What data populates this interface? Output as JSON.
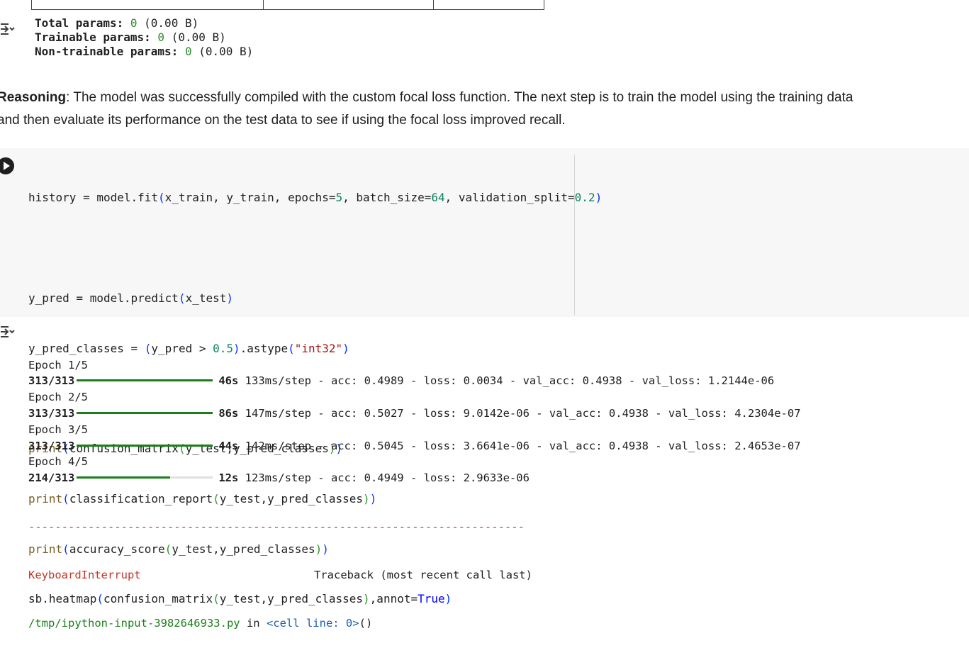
{
  "params": {
    "total_label": "Total params:",
    "total_value": "0",
    "total_size": "(0.00 B)",
    "trainable_label": "Trainable params:",
    "trainable_value": "0",
    "trainable_size": "(0.00 B)",
    "nontrainable_label": "Non-trainable params:",
    "nontrainable_value": "0",
    "nontrainable_size": "(0.00 B)"
  },
  "reasoning": {
    "label": "Reasoning",
    "text": ": The model was successfully compiled with the custom focal loss function. The next step is to train the model using the training data and then evaluate its performance on the test data to see if using the focal loss improved recall."
  },
  "code": {
    "l1_a": "history = model.fit",
    "l1_b": "(",
    "l1_c": "x_train, y_train, epochs=",
    "l1_d": "5",
    "l1_e": ", batch_size=",
    "l1_f": "64",
    "l1_g": ", validation_split=",
    "l1_h": "0.2",
    "l1_i": ")",
    "l3_a": "y_pred = model.predict",
    "l3_b": "(",
    "l3_c": "x_test",
    "l3_d": ")",
    "l4_a": "y_pred_classes = ",
    "l4_b": "(",
    "l4_c": "y_pred > ",
    "l4_d": "0.5",
    "l4_e": ")",
    "l4_f": ".astype",
    "l4_g": "(",
    "l4_h": "\"int32\"",
    "l4_i": ")",
    "l6_a": "print",
    "l6_b": "(",
    "l6_c": "confusion_matrix",
    "l6_d": "(",
    "l6_e": "y_test,y_pred_classes",
    "l6_f": ")",
    "l6_g": ")",
    "l7_a": "print",
    "l7_b": "(",
    "l7_c": "classification_report",
    "l7_d": "(",
    "l7_e": "y_test,y_pred_classes",
    "l7_f": ")",
    "l7_g": ")",
    "l8_a": "print",
    "l8_b": "(",
    "l8_c": "accuracy_score",
    "l8_d": "(",
    "l8_e": "y_test,y_pred_classes",
    "l8_f": ")",
    "l8_g": ")",
    "l9_a": "sb.heatmap",
    "l9_b": "(",
    "l9_c": "confusion_matrix",
    "l9_d": "(",
    "l9_e": "y_test,y_pred_classes",
    "l9_f": ")",
    "l9_g": ",annot=",
    "l9_h": "True",
    "l9_i": ")"
  },
  "output": {
    "epochs": [
      {
        "header": "Epoch 1/5",
        "steps": "313/313",
        "progress": 1.0,
        "time": "46s",
        "rest": " 133ms/step - acc: 0.4989 - loss: 0.0034 - val_acc: 0.4938 - val_loss: 1.2144e-06"
      },
      {
        "header": "Epoch 2/5",
        "steps": "313/313",
        "progress": 1.0,
        "time": "86s",
        "rest": " 147ms/step - acc: 0.5027 - loss: 9.0142e-06 - val_acc: 0.4938 - val_loss: 4.2304e-07"
      },
      {
        "header": "Epoch 3/5",
        "steps": "313/313",
        "progress": 1.0,
        "time": "44s",
        "rest": " 142ms/step - acc: 0.5045 - loss: 3.6641e-06 - val_acc: 0.4938 - val_loss: 2.4653e-07"
      },
      {
        "header": "Epoch 4/5",
        "steps": "214/313",
        "progress": 0.684,
        "time": "12s",
        "rest": " 123ms/step - acc: 0.4949 - loss: 2.9633e-06"
      }
    ],
    "dashes": "---------------------------------------------------------------------------",
    "error_name": "KeyboardInterrupt",
    "traceback": "Traceback (most recent call last)",
    "path": "/tmp/ipython-input-3982646933.py",
    "in_text": " in ",
    "cell_ref": "<cell line: 0>",
    "call": "()"
  }
}
